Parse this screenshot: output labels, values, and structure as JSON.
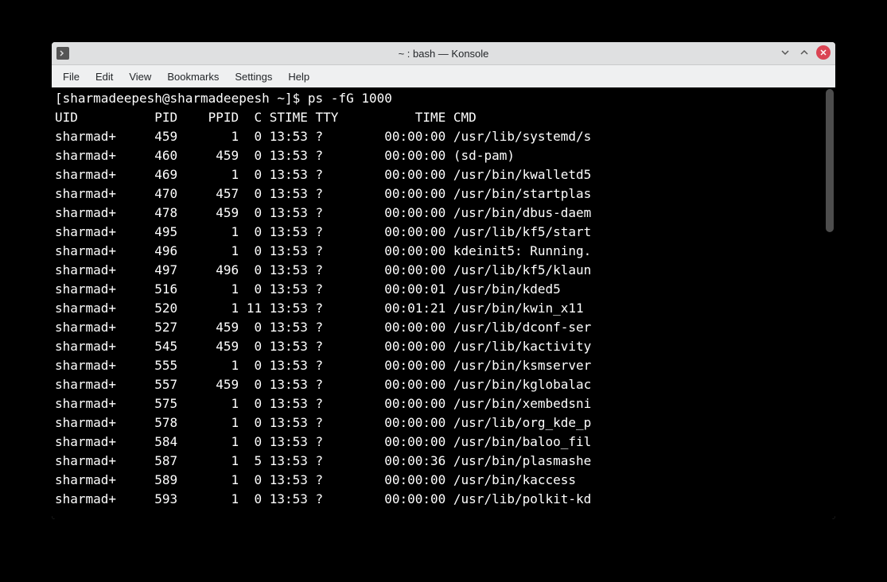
{
  "window": {
    "title": "~ : bash — Konsole"
  },
  "menubar": [
    "File",
    "Edit",
    "View",
    "Bookmarks",
    "Settings",
    "Help"
  ],
  "prompt": {
    "open": "[",
    "user_host": "sharmadeepesh@sharmadeepesh",
    "path": " ~",
    "close": "]$ ",
    "command": "ps -fG 1000"
  },
  "header": "UID          PID    PPID  C STIME TTY          TIME CMD",
  "rows": [
    "sharmad+     459       1  0 13:53 ?        00:00:00 /usr/lib/systemd/s",
    "sharmad+     460     459  0 13:53 ?        00:00:00 (sd-pam)",
    "sharmad+     469       1  0 13:53 ?        00:00:00 /usr/bin/kwalletd5",
    "sharmad+     470     457  0 13:53 ?        00:00:00 /usr/bin/startplas",
    "sharmad+     478     459  0 13:53 ?        00:00:00 /usr/bin/dbus-daem",
    "sharmad+     495       1  0 13:53 ?        00:00:00 /usr/lib/kf5/start",
    "sharmad+     496       1  0 13:53 ?        00:00:00 kdeinit5: Running.",
    "sharmad+     497     496  0 13:53 ?        00:00:00 /usr/lib/kf5/klaun",
    "sharmad+     516       1  0 13:53 ?        00:00:01 /usr/bin/kded5",
    "sharmad+     520       1 11 13:53 ?        00:01:21 /usr/bin/kwin_x11",
    "sharmad+     527     459  0 13:53 ?        00:00:00 /usr/lib/dconf-ser",
    "sharmad+     545     459  0 13:53 ?        00:00:00 /usr/lib/kactivity",
    "sharmad+     555       1  0 13:53 ?        00:00:00 /usr/bin/ksmserver",
    "sharmad+     557     459  0 13:53 ?        00:00:00 /usr/bin/kglobalac",
    "sharmad+     575       1  0 13:53 ?        00:00:00 /usr/bin/xembedsni",
    "sharmad+     578       1  0 13:53 ?        00:00:00 /usr/lib/org_kde_p",
    "sharmad+     584       1  0 13:53 ?        00:00:00 /usr/bin/baloo_fil",
    "sharmad+     587       1  5 13:53 ?        00:00:36 /usr/bin/plasmashe",
    "sharmad+     589       1  0 13:53 ?        00:00:00 /usr/bin/kaccess",
    "sharmad+     593       1  0 13:53 ?        00:00:00 /usr/lib/polkit-kd"
  ]
}
